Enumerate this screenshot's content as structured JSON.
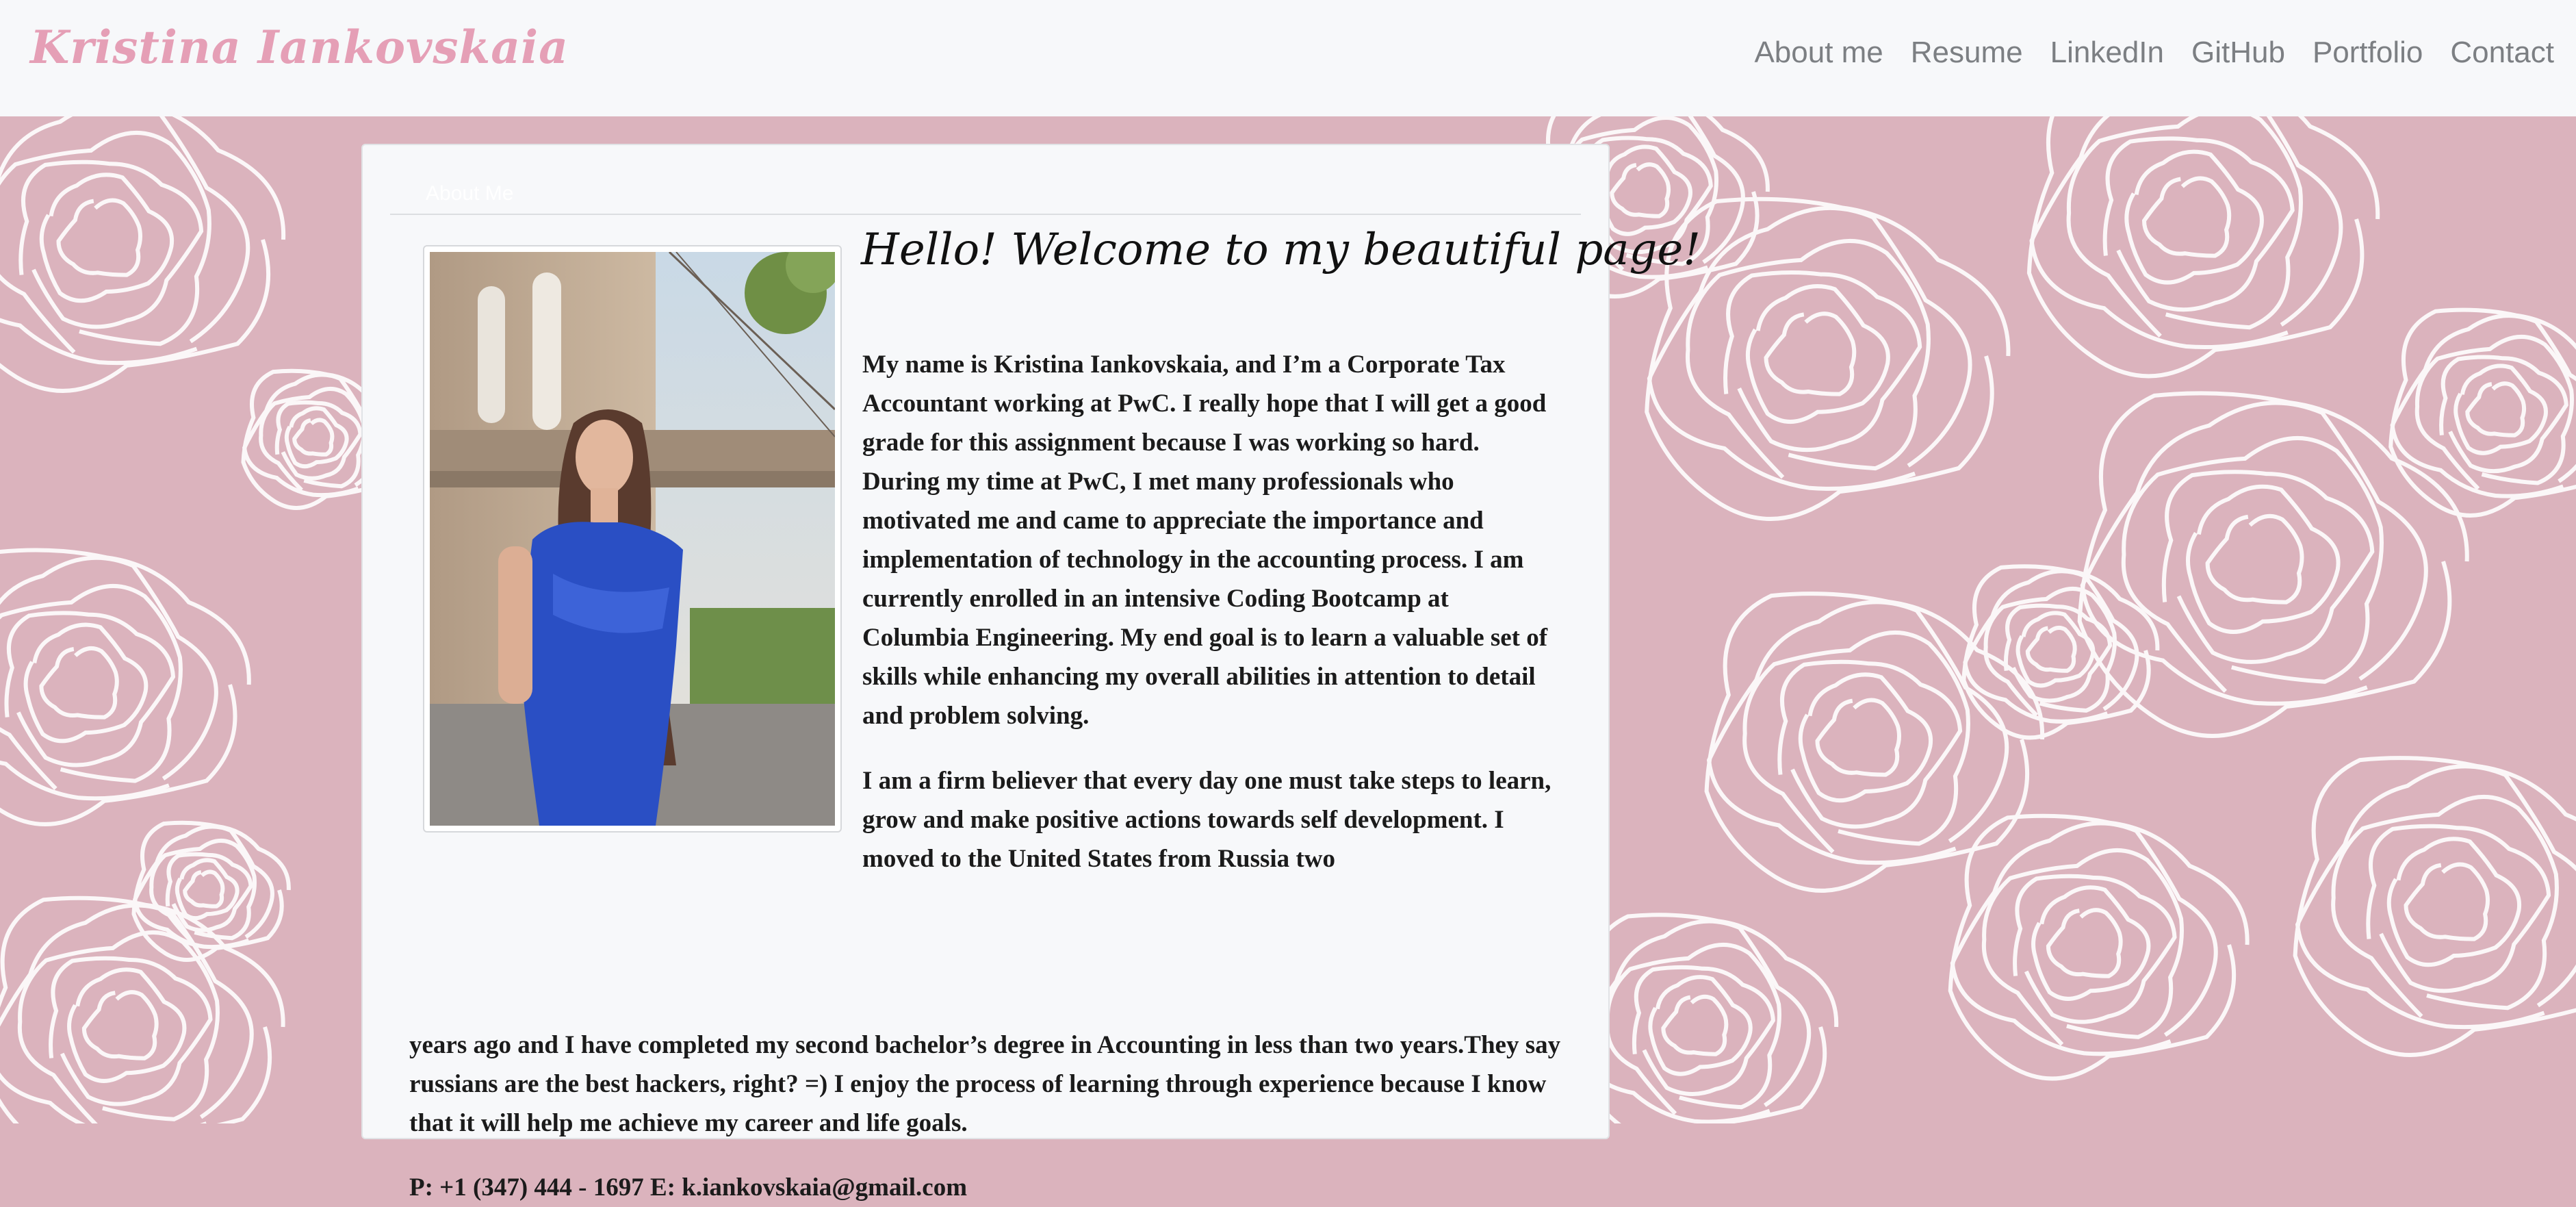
{
  "brand": "Kristina Iankovskaia",
  "nav": {
    "about": "About me",
    "resume": "Resume",
    "linkedin": "LinkedIn",
    "github": "GitHub",
    "portfolio": "Portfolio",
    "contact": "Contact"
  },
  "card": {
    "header": "About Me",
    "welcome": "Hello! Welcome to my beautiful page!",
    "paragraph1": "My name is Kristina Iankovskaia, and I’m a Corporate Tax Accountant working at PwC. I really hope that I will get a good grade for this assignment because I was working so hard. During my time at PwC, I met many professionals who motivated me and came to appreciate the importance and implementation of technology in the accounting process. I am currently enrolled in an intensive Coding Bootcamp at Columbia Engineering. My end goal is to learn a valuable set of skills while enhancing my overall abilities in attention to detail and problem solving.",
    "paragraph2a": "I am a firm believer that every day one must take steps to learn, grow and make positive actions towards self development. I moved to the United States from Russia two",
    "paragraph2b": "years ago and I have completed my second bachelor’s degree in Accounting in less than two years.They say russians are the best hackers, right? =) I enjoy the process of learning through experience because I know that it will help me achieve my career and life goals.",
    "contact": "P: +1 (347) 444 - 1697 E: k.iankovskaia@gmail.com"
  },
  "colors": {
    "brand": "#e59fb6",
    "background_pattern": "#dbb3bd",
    "nav_text": "#7c7f83",
    "card_bg": "#f7f8fa"
  }
}
